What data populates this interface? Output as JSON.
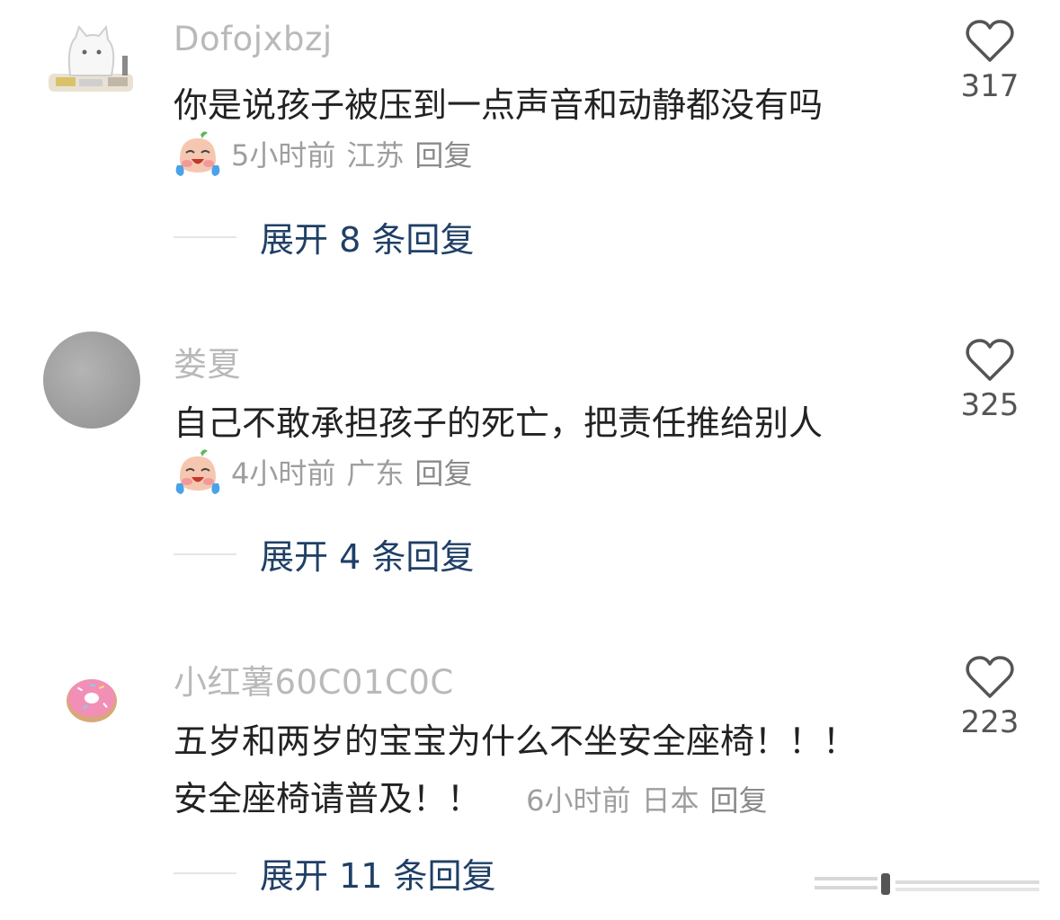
{
  "comments": [
    {
      "username": "Dofojxbzj",
      "avatar": "cat-at-desk",
      "text_lines": [
        "你是说孩子被压到一点声音和动静都没有吗"
      ],
      "emoji": "crying-face",
      "time": "5小时前",
      "location": "江苏",
      "reply_label": "回复",
      "likes": "317",
      "expand_label": "展开 8 条回复"
    },
    {
      "username": "娄夏",
      "avatar": "grey-circle",
      "text_lines": [
        "自己不敢承担孩子的死亡，把责任推给别人"
      ],
      "emoji": "crying-face",
      "time": "4小时前",
      "location": "广东",
      "reply_label": "回复",
      "likes": "325",
      "expand_label": "展开 4 条回复"
    },
    {
      "username": "小红薯60C01C0C",
      "avatar": "pink-donut",
      "text_lines": [
        "五岁和两岁的宝宝为什么不坐安全座椅！！！",
        "安全座椅请普及！！"
      ],
      "time": "6小时前",
      "location": "日本",
      "reply_label": "回复",
      "likes": "223",
      "expand_label": "展开 11 条回复"
    }
  ],
  "colors": {
    "username": "#b9b9b9",
    "text": "#222222",
    "meta": "#9e9e9e",
    "expand": "#1f3f66",
    "like_count": "#555555"
  }
}
